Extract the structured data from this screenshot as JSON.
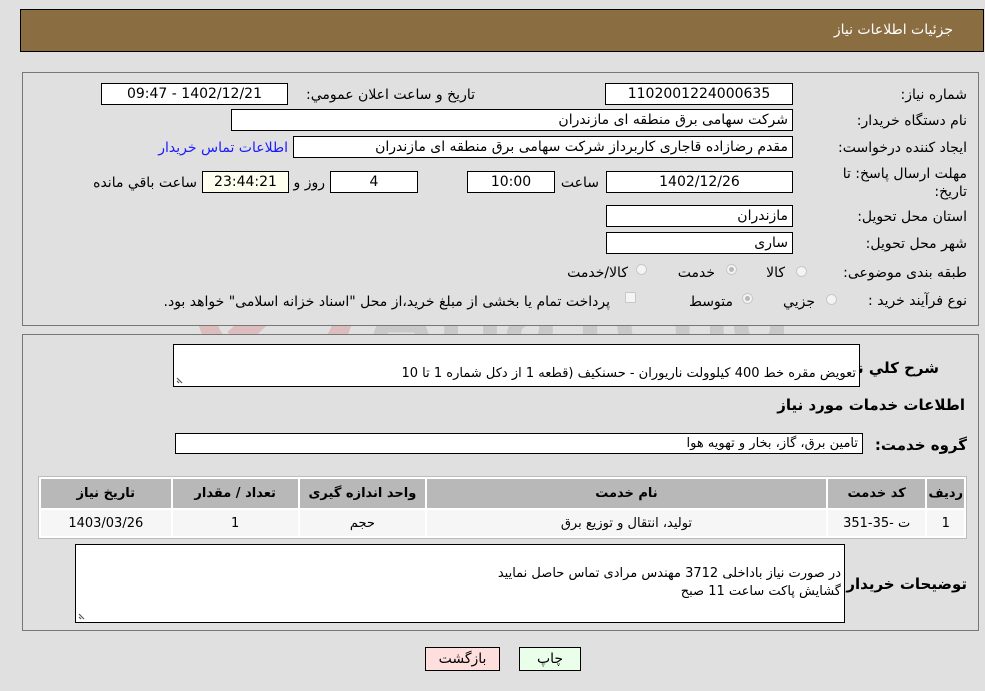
{
  "header": {
    "title": "جزئیات اطلاعات نیاز"
  },
  "form": {
    "need_number": {
      "label": "شماره نیاز:",
      "value": "1102001224000635"
    },
    "announce_datetime": {
      "label": "تاریخ و ساعت اعلان عمومي:",
      "value": "1402/12/21 - 09:47"
    },
    "buyer_org": {
      "label": "نام دستگاه خریدار:",
      "value": "شرکت سهامی برق منطقه ای مازندران"
    },
    "requester": {
      "label": "ایجاد کننده درخواست:",
      "value": "مقدم رضازاده قاجاری کاربرداز شرکت سهامی برق منطقه ای مازندران"
    },
    "buyer_contact_link": "اطلاعات تماس خریدار",
    "deadline": {
      "label": "مهلت ارسال پاسخ: تا تاریخ:",
      "date": "1402/12/26",
      "time_label": "ساعت",
      "time": "10:00",
      "days": "4",
      "days_label": "روز و",
      "remaining": "23:44:21",
      "remaining_label": "ساعت باقي مانده"
    },
    "province": {
      "label": "استان محل تحویل:",
      "value": "مازندران"
    },
    "city": {
      "label": "شهر محل تحویل:",
      "value": "ساری"
    },
    "category": {
      "label": "طبقه بندی موضوعی:",
      "options": [
        "کالا",
        "خدمت",
        "کالا/خدمت"
      ],
      "selected": "خدمت"
    },
    "purchase_type": {
      "label": "نوع فرآیند خرید :",
      "options": [
        "جزيي",
        "متوسط"
      ],
      "selected": "متوسط",
      "treasury_note": "پرداخت تمام یا بخشی از مبلغ خرید،از محل \"اسناد خزانه اسلامی\" خواهد بود."
    }
  },
  "description": {
    "label": "شرح كلي نياز:",
    "value": "تعویض مقره خط 400 کیلوولت ناریوران - حسنکیف (قطعه 1 از دکل شماره 1 تا 10"
  },
  "services": {
    "section_title": "اطلاعات خدمات مورد نياز",
    "group_label": "گروه خدمت:",
    "group_value": "تامین برق، گاز، بخار و تهویه هوا",
    "table": {
      "headers": [
        "رديف",
        "كد خدمت",
        "نام خدمت",
        "واحد اندازه گيری",
        "تعداد / مقدار",
        "تاريخ نياز"
      ],
      "rows": [
        [
          "1",
          "ت -35-351",
          "تولید، انتقال و توزیع برق",
          "حجم",
          "1",
          "1403/03/26"
        ]
      ]
    }
  },
  "buyer_notes": {
    "label": "توضيحات خريدار:",
    "value": "در صورت نیاز باداخلی 3712 مهندس مرادی تماس حاصل نمایید\nگشایش پاکت ساعت 11 صبح"
  },
  "buttons": {
    "print": "چاپ",
    "back": "بازگشت"
  },
  "colors": {
    "header_bg": "#8b6d42",
    "print_bg": "#eaffea",
    "back_bg": "#ffdede",
    "link": "#1a1aff"
  }
}
